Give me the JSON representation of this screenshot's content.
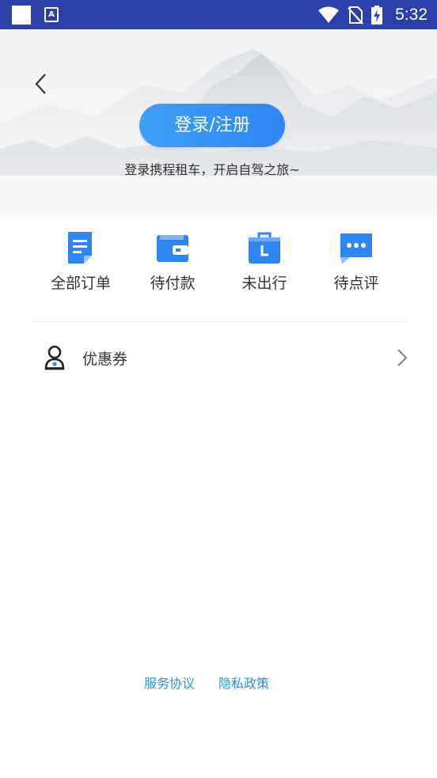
{
  "status_bar": {
    "app_icon_letter": "A",
    "time": "5:32",
    "icons": [
      "wifi-icon",
      "no-sim-icon",
      "battery-charging-icon"
    ]
  },
  "header": {
    "back_icon": "chevron-left-icon",
    "login_button_label": "登录/注册",
    "login_tip": "登录携程租车，开启自驾之旅~"
  },
  "orders": [
    {
      "label": "全部订单",
      "icon": "document-icon",
      "color": "#2f85f2"
    },
    {
      "label": "待付款",
      "icon": "wallet-icon",
      "color": "#2f85f2"
    },
    {
      "label": "未出行",
      "icon": "luggage-icon",
      "color": "#2f85f2"
    },
    {
      "label": "待点评",
      "icon": "chat-bubble-icon",
      "color": "#2f85f2"
    }
  ],
  "menu": {
    "coupon_label": "优惠券",
    "coupon_icon": "person-icon",
    "arrow_icon": "chevron-right-icon"
  },
  "footer": {
    "service_agreement": "服务协议",
    "privacy_policy": "隐私政策"
  },
  "colors": {
    "status_bar": "#2d3fa8",
    "accent": "#2f85f2",
    "link": "#2c91d6"
  }
}
